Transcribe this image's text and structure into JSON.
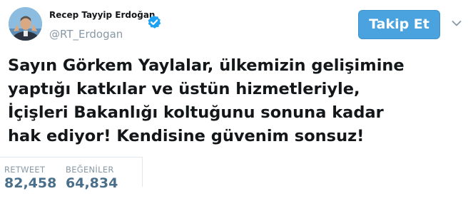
{
  "author": {
    "name": "Recep Tayyip Erdoğan",
    "handle": "@RT_Erdogan",
    "avatar_icon": "profile-photo",
    "verified_icon": "verified-badge-icon"
  },
  "actions": {
    "follow_label": "Takip Et",
    "menu_icon": "chevron-down-icon"
  },
  "tweet": {
    "lines": [
      "Sayın Görkem Yaylalar, ülkemizin gelişimine",
      "yaptığı katkılar ve üstün hizmetleriyle,",
      "İçişleri Bakanlığı koltuğunu sonuna kadar",
      "hak ediyor! Kendisine güvenim sonsuz!"
    ]
  },
  "stats": {
    "retweets_label": "RETWEET",
    "retweets_value": "82,458",
    "likes_label": "BEĞENİLER",
    "likes_value": "64,834"
  },
  "colors": {
    "accent": "#4aa3df",
    "verified": "#1da1f2",
    "stat_value": "#4a6f8a",
    "muted": "#8899a6"
  }
}
